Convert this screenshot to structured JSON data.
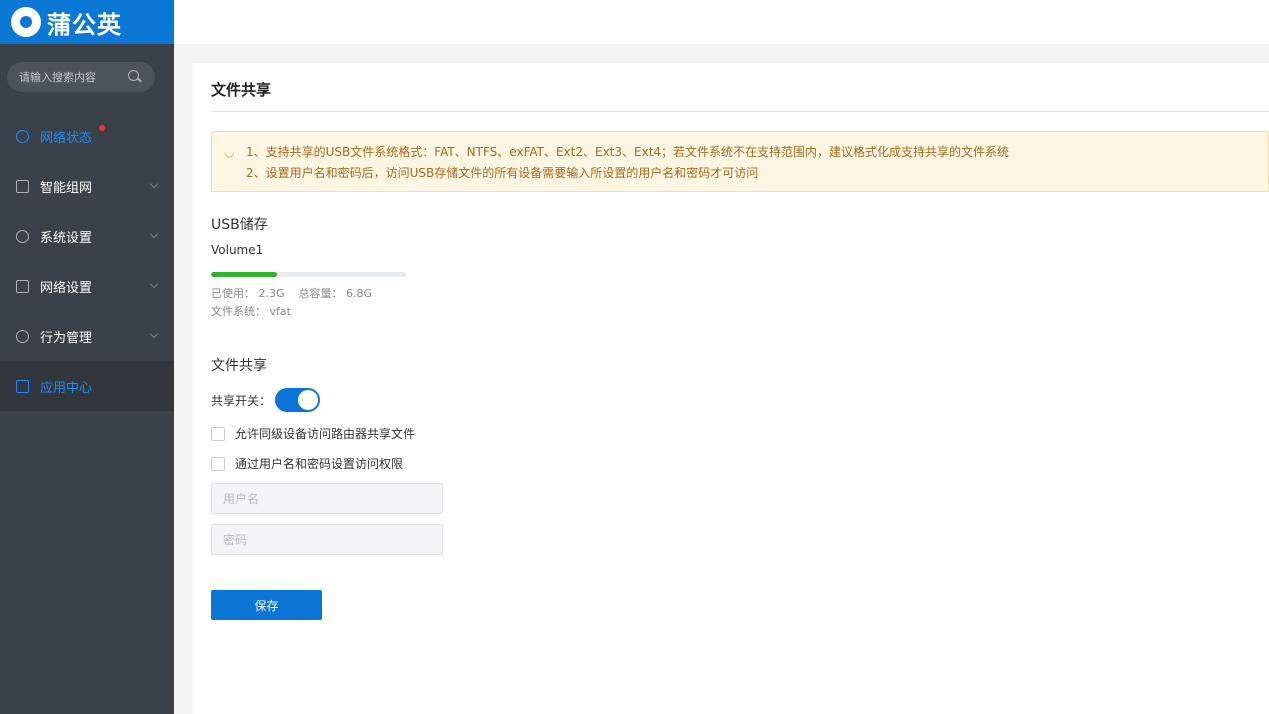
{
  "brand": {
    "name": "蒲公英"
  },
  "search": {
    "placeholder": "请输入搜索内容"
  },
  "nav": {
    "items": [
      {
        "label": "网络状态"
      },
      {
        "label": "智能组网"
      },
      {
        "label": "系统设置"
      },
      {
        "label": "网络设置"
      },
      {
        "label": "行为管理"
      },
      {
        "label": "应用中心"
      }
    ]
  },
  "page": {
    "title": "文件共享"
  },
  "notice": {
    "line1": "1、支持共享的USB文件系统格式：FAT、NTFS、exFAT、Ext2、Ext3、Ext4；若文件系统不在支持范围内，建议格式化成支持共享的文件系统",
    "line2": "2、设置用户名和密码后，访问USB存储文件的所有设备需要输入所设置的用户名和密码才可访问"
  },
  "usb": {
    "section_title": "USB储存",
    "volume": "Volume1",
    "used_label": "已使用：",
    "used_value": "2.3G",
    "total_label": "总容量：",
    "total_value": "6.8G",
    "fs_label": "文件系统：",
    "fs_value": "vfat",
    "usage_fraction": 0.338
  },
  "share": {
    "section_title": "文件共享",
    "switch_label": "共享开关：",
    "switch_on": true,
    "option1": "允许同级设备访问路由器共享文件",
    "option2": "通过用户名和密码设置访问权限",
    "username_placeholder": "用户名",
    "password_placeholder": "密码",
    "save_label": "保存"
  },
  "colors": {
    "brand": "#0a78d4",
    "sidebar": "#3b4148",
    "active_nav": "#1a8cff",
    "progress": "#2db52d",
    "notice_bg": "#fdf6e3",
    "notice_text": "#a46a1f"
  }
}
